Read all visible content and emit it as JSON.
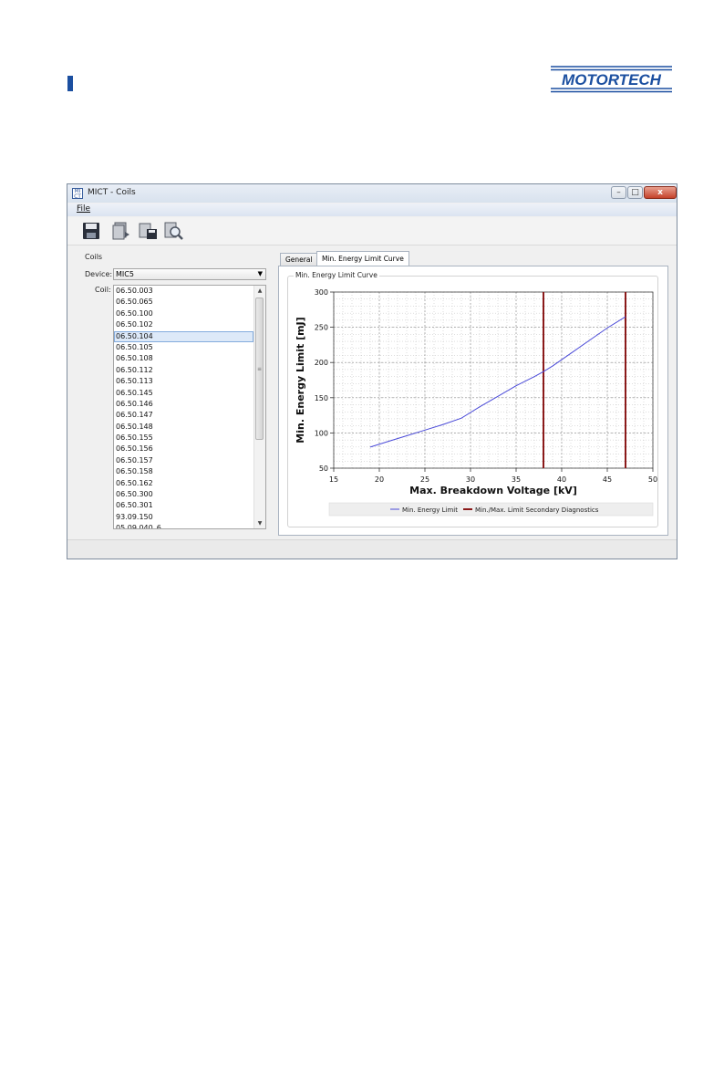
{
  "brand": {
    "logo_text": "MOTORTECH",
    "logo_color": "#1b4fa0"
  },
  "window": {
    "title": "MICT - Coils",
    "app_icon": "MI CT",
    "controls": {
      "minimize": "–",
      "maximize": "□",
      "close": "x"
    }
  },
  "menu": {
    "file": "File"
  },
  "toolbar": {
    "icons": [
      "save-icon",
      "export-icon",
      "save-as-icon",
      "search-icon"
    ]
  },
  "coils": {
    "group_title": "Coils",
    "device_label": "Device:",
    "device_value": "MIC5",
    "coil_label": "Coil:",
    "items": [
      "06.50.003",
      "06.50.065",
      "06.50.100",
      "06.50.102",
      "06.50.104",
      "06.50.105",
      "06.50.108",
      "06.50.112",
      "06.50.113",
      "06.50.145",
      "06.50.146",
      "06.50.147",
      "06.50.148",
      "06.50.155",
      "06.50.156",
      "06.50.157",
      "06.50.158",
      "06.50.162",
      "06.50.300",
      "06.50.301",
      "93.09.150",
      "05.09.040_6"
    ],
    "selected_index": 4
  },
  "tabs": {
    "general": "General",
    "curve": "Min. Energy Limit Curve"
  },
  "chart_group_label": "Min. Energy Limit Curve",
  "chart_data": {
    "type": "line",
    "xlabel": "Max. Breakdown Voltage [kV]",
    "ylabel": "Min. Energy Limit [mJ]",
    "xlim": [
      15,
      50
    ],
    "ylim": [
      50,
      300
    ],
    "x_ticks": [
      15,
      20,
      25,
      30,
      35,
      40,
      45,
      50
    ],
    "y_ticks": [
      50,
      100,
      150,
      200,
      250,
      300
    ],
    "grid": true,
    "legend_position": "bottom",
    "series": [
      {
        "name": "Min. Energy Limit",
        "color": "#4a4ad8",
        "x": [
          19,
          21,
          23,
          25,
          27,
          29,
          31,
          33,
          35,
          37,
          38,
          39,
          41,
          43,
          45,
          47
        ],
        "y": [
          80,
          88,
          96,
          104,
          112,
          121,
          137,
          152,
          167,
          180,
          187,
          195,
          213,
          231,
          249,
          265
        ]
      },
      {
        "name": "Min./Max. Limit Secondary Diagnostics",
        "color": "#8b1a1a",
        "vertical_lines": [
          38,
          47
        ]
      }
    ]
  }
}
